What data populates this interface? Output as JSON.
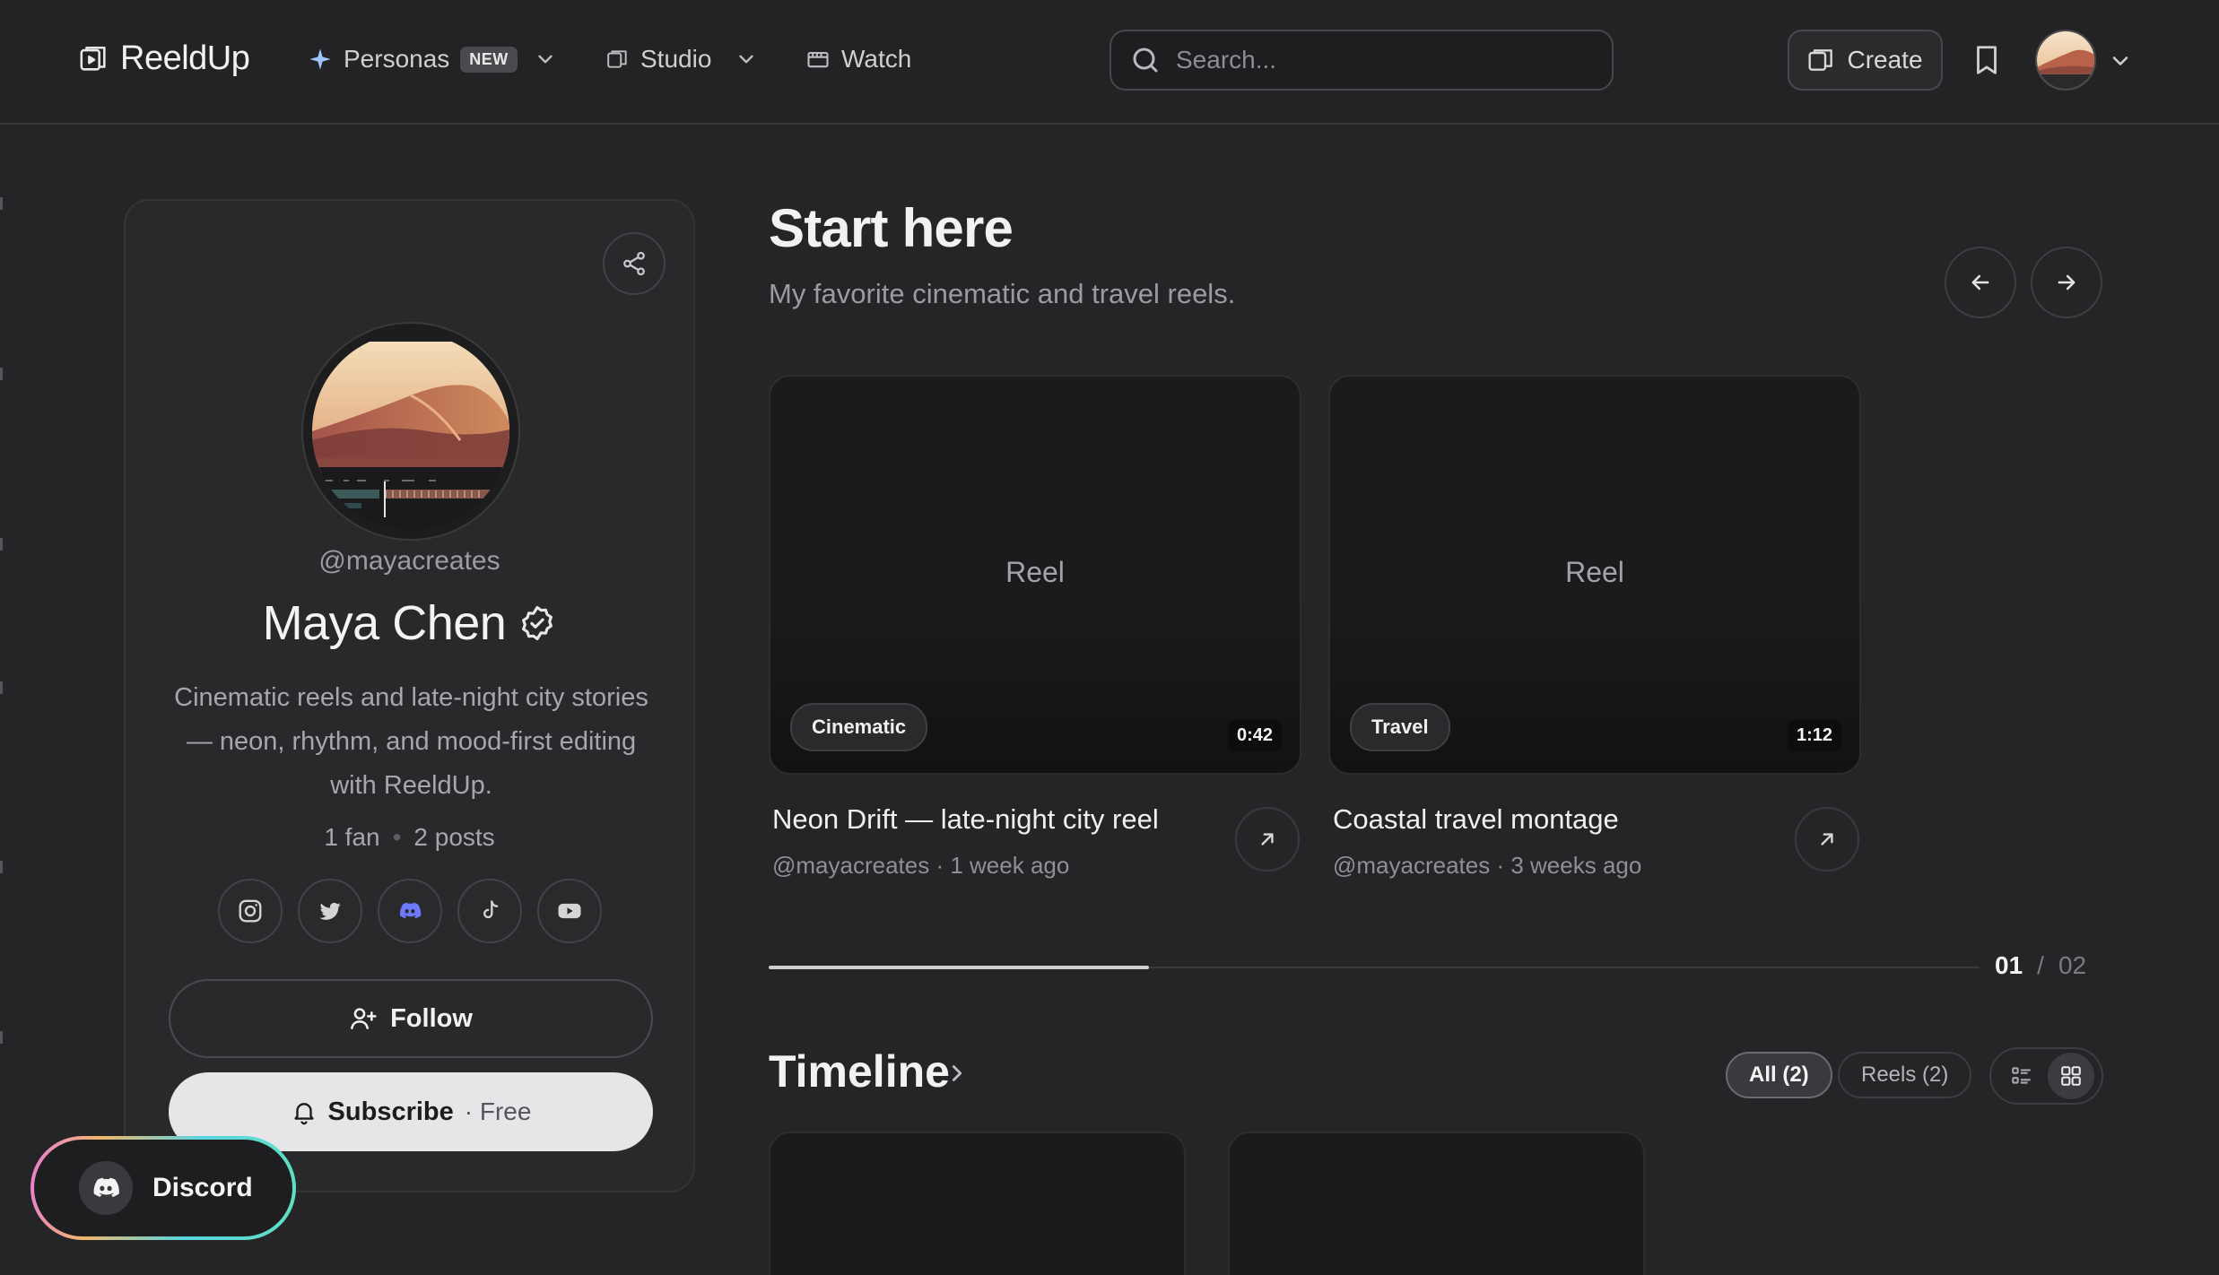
{
  "nav": {
    "brand": "ReeldUp",
    "personas_label": "Personas",
    "personas_badge": "NEW",
    "studio_label": "Studio",
    "watch_label": "Watch",
    "search_placeholder": "Search...",
    "create_label": "Create"
  },
  "profile": {
    "handle": "@mayacreates",
    "name": "Maya Chen",
    "bio": "Cinematic reels and late-night city stories — neon, rhythm, and mood-first editing with ReeldUp.",
    "fans": "1 fan",
    "stats_separator": "•",
    "posts": "2 posts",
    "socials": [
      "instagram-icon",
      "twitter-icon",
      "discord-icon",
      "tiktok-icon",
      "youtube-icon"
    ],
    "follow_label": "Follow",
    "subscribe_label": "Subscribe",
    "subscribe_price": "· Free"
  },
  "discord_widget": {
    "label": "Discord"
  },
  "start_here": {
    "title": "Start here",
    "subtitle": "My favorite cinematic and travel reels.",
    "reels": [
      {
        "placeholder": "Reel",
        "tag": "Cinematic",
        "duration": "0:42",
        "title": "Neon Drift — late-night city reel",
        "meta": "@mayacreates · 1 week ago"
      },
      {
        "placeholder": "Reel",
        "tag": "Travel",
        "duration": "1:12",
        "title": "Coastal travel montage",
        "meta": "@mayacreates · 3 weeks ago"
      }
    ],
    "pager": {
      "current": "01",
      "separator": "/",
      "total": "02"
    },
    "progress_fraction": 0.314
  },
  "timeline": {
    "title": "Timeline",
    "filters": [
      "All (2)",
      "Reels (2)"
    ],
    "active_filter": "All (2)",
    "view_modes": [
      "list-view-icon",
      "grid-view-icon"
    ],
    "active_view": "grid-view-icon"
  },
  "colors": {
    "background": "#252527",
    "card": "#29292c",
    "discord_accent": "#5865f2",
    "gradient_ring": [
      "#e87ad8",
      "#f0b76a",
      "#5ad5e0",
      "#5ee0c0"
    ]
  }
}
